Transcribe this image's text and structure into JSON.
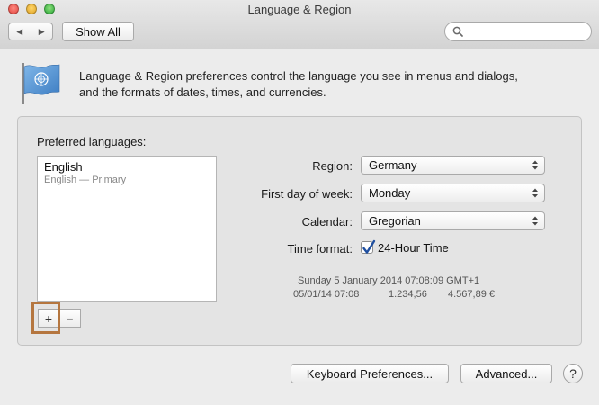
{
  "window": {
    "title": "Language & Region"
  },
  "toolbar": {
    "back_glyph": "◀",
    "forward_glyph": "▶",
    "show_all_label": "Show All",
    "search": {
      "value": "",
      "placeholder": ""
    }
  },
  "header": {
    "icon": "un-flag-icon",
    "description_line1": "Language & Region preferences control the language you see in menus and dialogs,",
    "description_line2": "and the formats of dates, times, and currencies."
  },
  "languages": {
    "label": "Preferred languages:",
    "items": [
      {
        "name": "English",
        "detail": "English — Primary"
      }
    ],
    "add_label": "+",
    "remove_label": "−"
  },
  "settings": {
    "region": {
      "label": "Region:",
      "value": "Germany"
    },
    "first_day": {
      "label": "First day of week:",
      "value": "Monday"
    },
    "calendar": {
      "label": "Calendar:",
      "value": "Gregorian"
    },
    "time_format": {
      "label": "Time format:",
      "checkbox_label": "24-Hour Time",
      "checked": true
    }
  },
  "sample": {
    "long_date": "Sunday 5 January 2014 07:08:09 GMT+1",
    "short_date": "05/01/14 07:08",
    "number": "1.234,56",
    "currency": "4.567,89 €"
  },
  "footer": {
    "keyboard_label": "Keyboard Preferences...",
    "advanced_label": "Advanced...",
    "help_label": "?"
  },
  "colors": {
    "highlight_box": "#b5763f"
  }
}
